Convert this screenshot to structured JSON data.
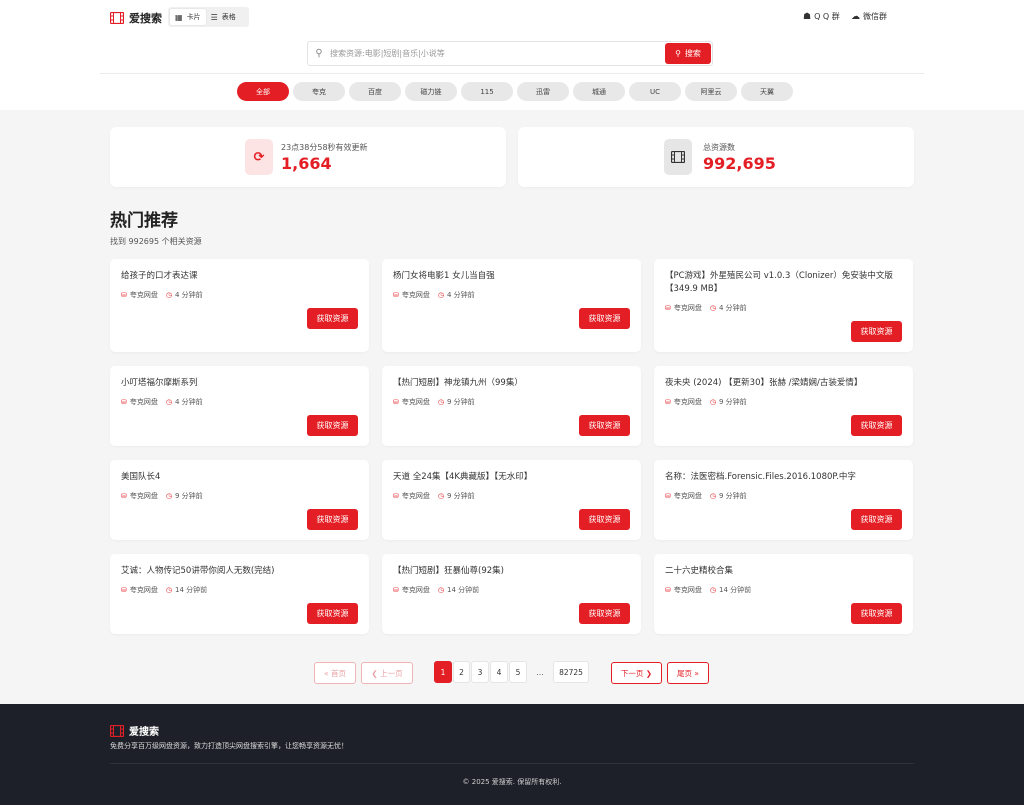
{
  "header": {
    "logo_text": "爱搜索",
    "view_card": "卡片",
    "view_table": "表格",
    "qq_group": "Q Q 群",
    "wechat_group": "微信群"
  },
  "search": {
    "placeholder": "搜索资源:电影|短剧|音乐|小说等",
    "button": "搜索"
  },
  "categories": [
    "全部",
    "夸克",
    "百度",
    "磁力链",
    "115",
    "迅雷",
    "城通",
    "UC",
    "阿里云",
    "天翼"
  ],
  "stats": {
    "update_label": "23点38分58秒有效更新",
    "update_value": "1,664",
    "total_label": "总资源数",
    "total_value": "992,695"
  },
  "section": {
    "title": "热门推荐",
    "subtitle": "找到 992695 个相关资源"
  },
  "cards": [
    {
      "title": "给孩子的口才表达课",
      "source": "夸克网盘",
      "time": "4 分钟前",
      "button": "获取资源"
    },
    {
      "title": "杨门女将电影1 女儿当自强",
      "source": "夸克网盘",
      "time": "4 分钟前",
      "button": "获取资源"
    },
    {
      "title": "【PC游戏】外星殖民公司 v1.0.3（Clonizer）免安装中文版【349.9 MB】",
      "source": "夸克网盘",
      "time": "4 分钟前",
      "button": "获取资源"
    },
    {
      "title": "小叮塔福尔摩斯系列",
      "source": "夸克网盘",
      "time": "4 分钟前",
      "button": "获取资源"
    },
    {
      "title": "【热门短剧】神龙镇九州（99集）",
      "source": "夸克网盘",
      "time": "9 分钟前",
      "button": "获取资源"
    },
    {
      "title": "夜未央 (2024) 【更新30】张赫 /梁婧娴/古装爱情】",
      "source": "夸克网盘",
      "time": "9 分钟前",
      "button": "获取资源"
    },
    {
      "title": "美国队长4",
      "source": "夸克网盘",
      "time": "9 分钟前",
      "button": "获取资源"
    },
    {
      "title": "天道 全24集【4K典藏版】【无水印】",
      "source": "夸克网盘",
      "time": "9 分钟前",
      "button": "获取资源"
    },
    {
      "title": "名称：法医密档.Forensic.Files.2016.1080P.中字",
      "source": "夸克网盘",
      "time": "9 分钟前",
      "button": "获取资源"
    },
    {
      "title": "艾诚：人物传记50讲带你阅人无数(完结)",
      "source": "夸克网盘",
      "time": "14 分钟前",
      "button": "获取资源"
    },
    {
      "title": "【热门短剧】狂暴仙尊(92集)",
      "source": "夸克网盘",
      "time": "14 分钟前",
      "button": "获取资源"
    },
    {
      "title": "二十六史精校合集",
      "source": "夸克网盘",
      "time": "14 分钟前",
      "button": "获取资源"
    }
  ],
  "pagination": {
    "first": "« 首页",
    "prev": "❮ 上一页",
    "pages": [
      "1",
      "2",
      "3",
      "4",
      "5"
    ],
    "ellipsis": "...",
    "last_page": "82725",
    "next": "下一页 ❯",
    "last": "尾页 »",
    "current": "1"
  },
  "footer": {
    "logo_text": "爱搜索",
    "description": "免费分享百万级网盘资源，致力打造顶尖网盘搜索引擎，让您畅享资源无忧！",
    "copyright": "© 2025 爱搜索. 保留所有权利."
  },
  "colors": {
    "accent": "#e31e24",
    "footer_bg": "#1e2029",
    "page_bg": "#f5f5f5"
  }
}
